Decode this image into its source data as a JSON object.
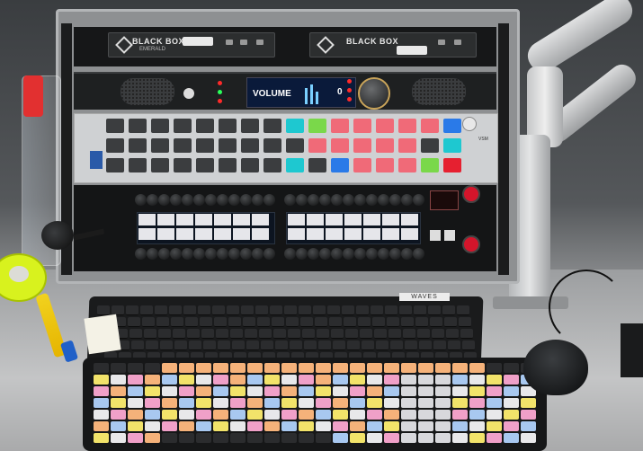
{
  "scene": {
    "description_kind": "photo",
    "rack": {
      "unit1": {
        "box_left": {
          "brand": "BLACK BOX",
          "model": "EMERALD"
        },
        "box_right": {
          "brand": "BLACK BOX"
        }
      },
      "unit2": {
        "display_label": "VOLUME",
        "display_digit": "0"
      },
      "unit3": {
        "side_label": "VSM"
      }
    },
    "keyboard_back_label": "WAVES",
    "colors": {
      "keycap_yellow": "#f2e36a",
      "keycap_pink": "#f0a0c8",
      "keycap_blue": "#a8c8f0",
      "keycap_orange": "#f5b27a",
      "panel_red": "#f06a78",
      "panel_cyan": "#1ec8d0",
      "panel_green": "#7ad84a",
      "tape_yellow": "#d8f21e"
    }
  }
}
